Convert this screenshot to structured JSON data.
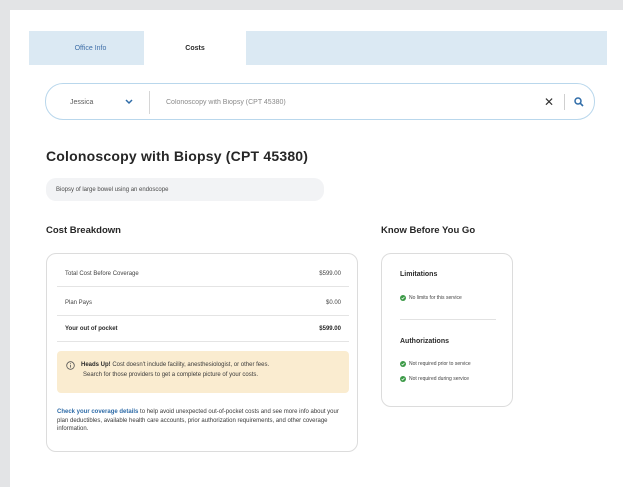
{
  "tabs": [
    {
      "label": "Office Info"
    },
    {
      "label": "Costs"
    }
  ],
  "search": {
    "user": "Jessica",
    "query": "Colonoscopy with Biopsy (CPT 45380)",
    "clear_label": "✕"
  },
  "procedure": {
    "title": "Colonoscopy with Biopsy (CPT 45380)",
    "description": "Biopsy of large bowel using an endoscope"
  },
  "cost_breakdown": {
    "heading": "Cost Breakdown",
    "rows": [
      {
        "label": "Total Cost Before Coverage",
        "value": "$599.00"
      },
      {
        "label": "Plan Pays",
        "value": "$0.00"
      },
      {
        "label": "Your out of pocket",
        "value": "$599.00"
      }
    ],
    "alert": {
      "title": "Heads Up!",
      "line1": "Cost doesn't include facility, anesthesiologist, or other fees.",
      "line2": "Search for those providers to get a complete picture of your costs."
    },
    "coverage_link": "Check your coverage details",
    "coverage_text": "to help avoid unexpected out-of-pocket costs and see more info about your plan deductibles, available health care accounts, prior authorization requirements, and other coverage information."
  },
  "know_before": {
    "heading": "Know Before You Go",
    "limitations_heading": "Limitations",
    "limitations_item": "No limits for this service",
    "authorizations_heading": "Authorizations",
    "auth_item1": "Not required prior to service",
    "auth_item2": "Not required during service"
  },
  "colors": {
    "accent": "#2f6ca8",
    "tab_bg": "#dbe9f3",
    "alert_bg": "#faecd0",
    "success": "#3c9a47"
  }
}
